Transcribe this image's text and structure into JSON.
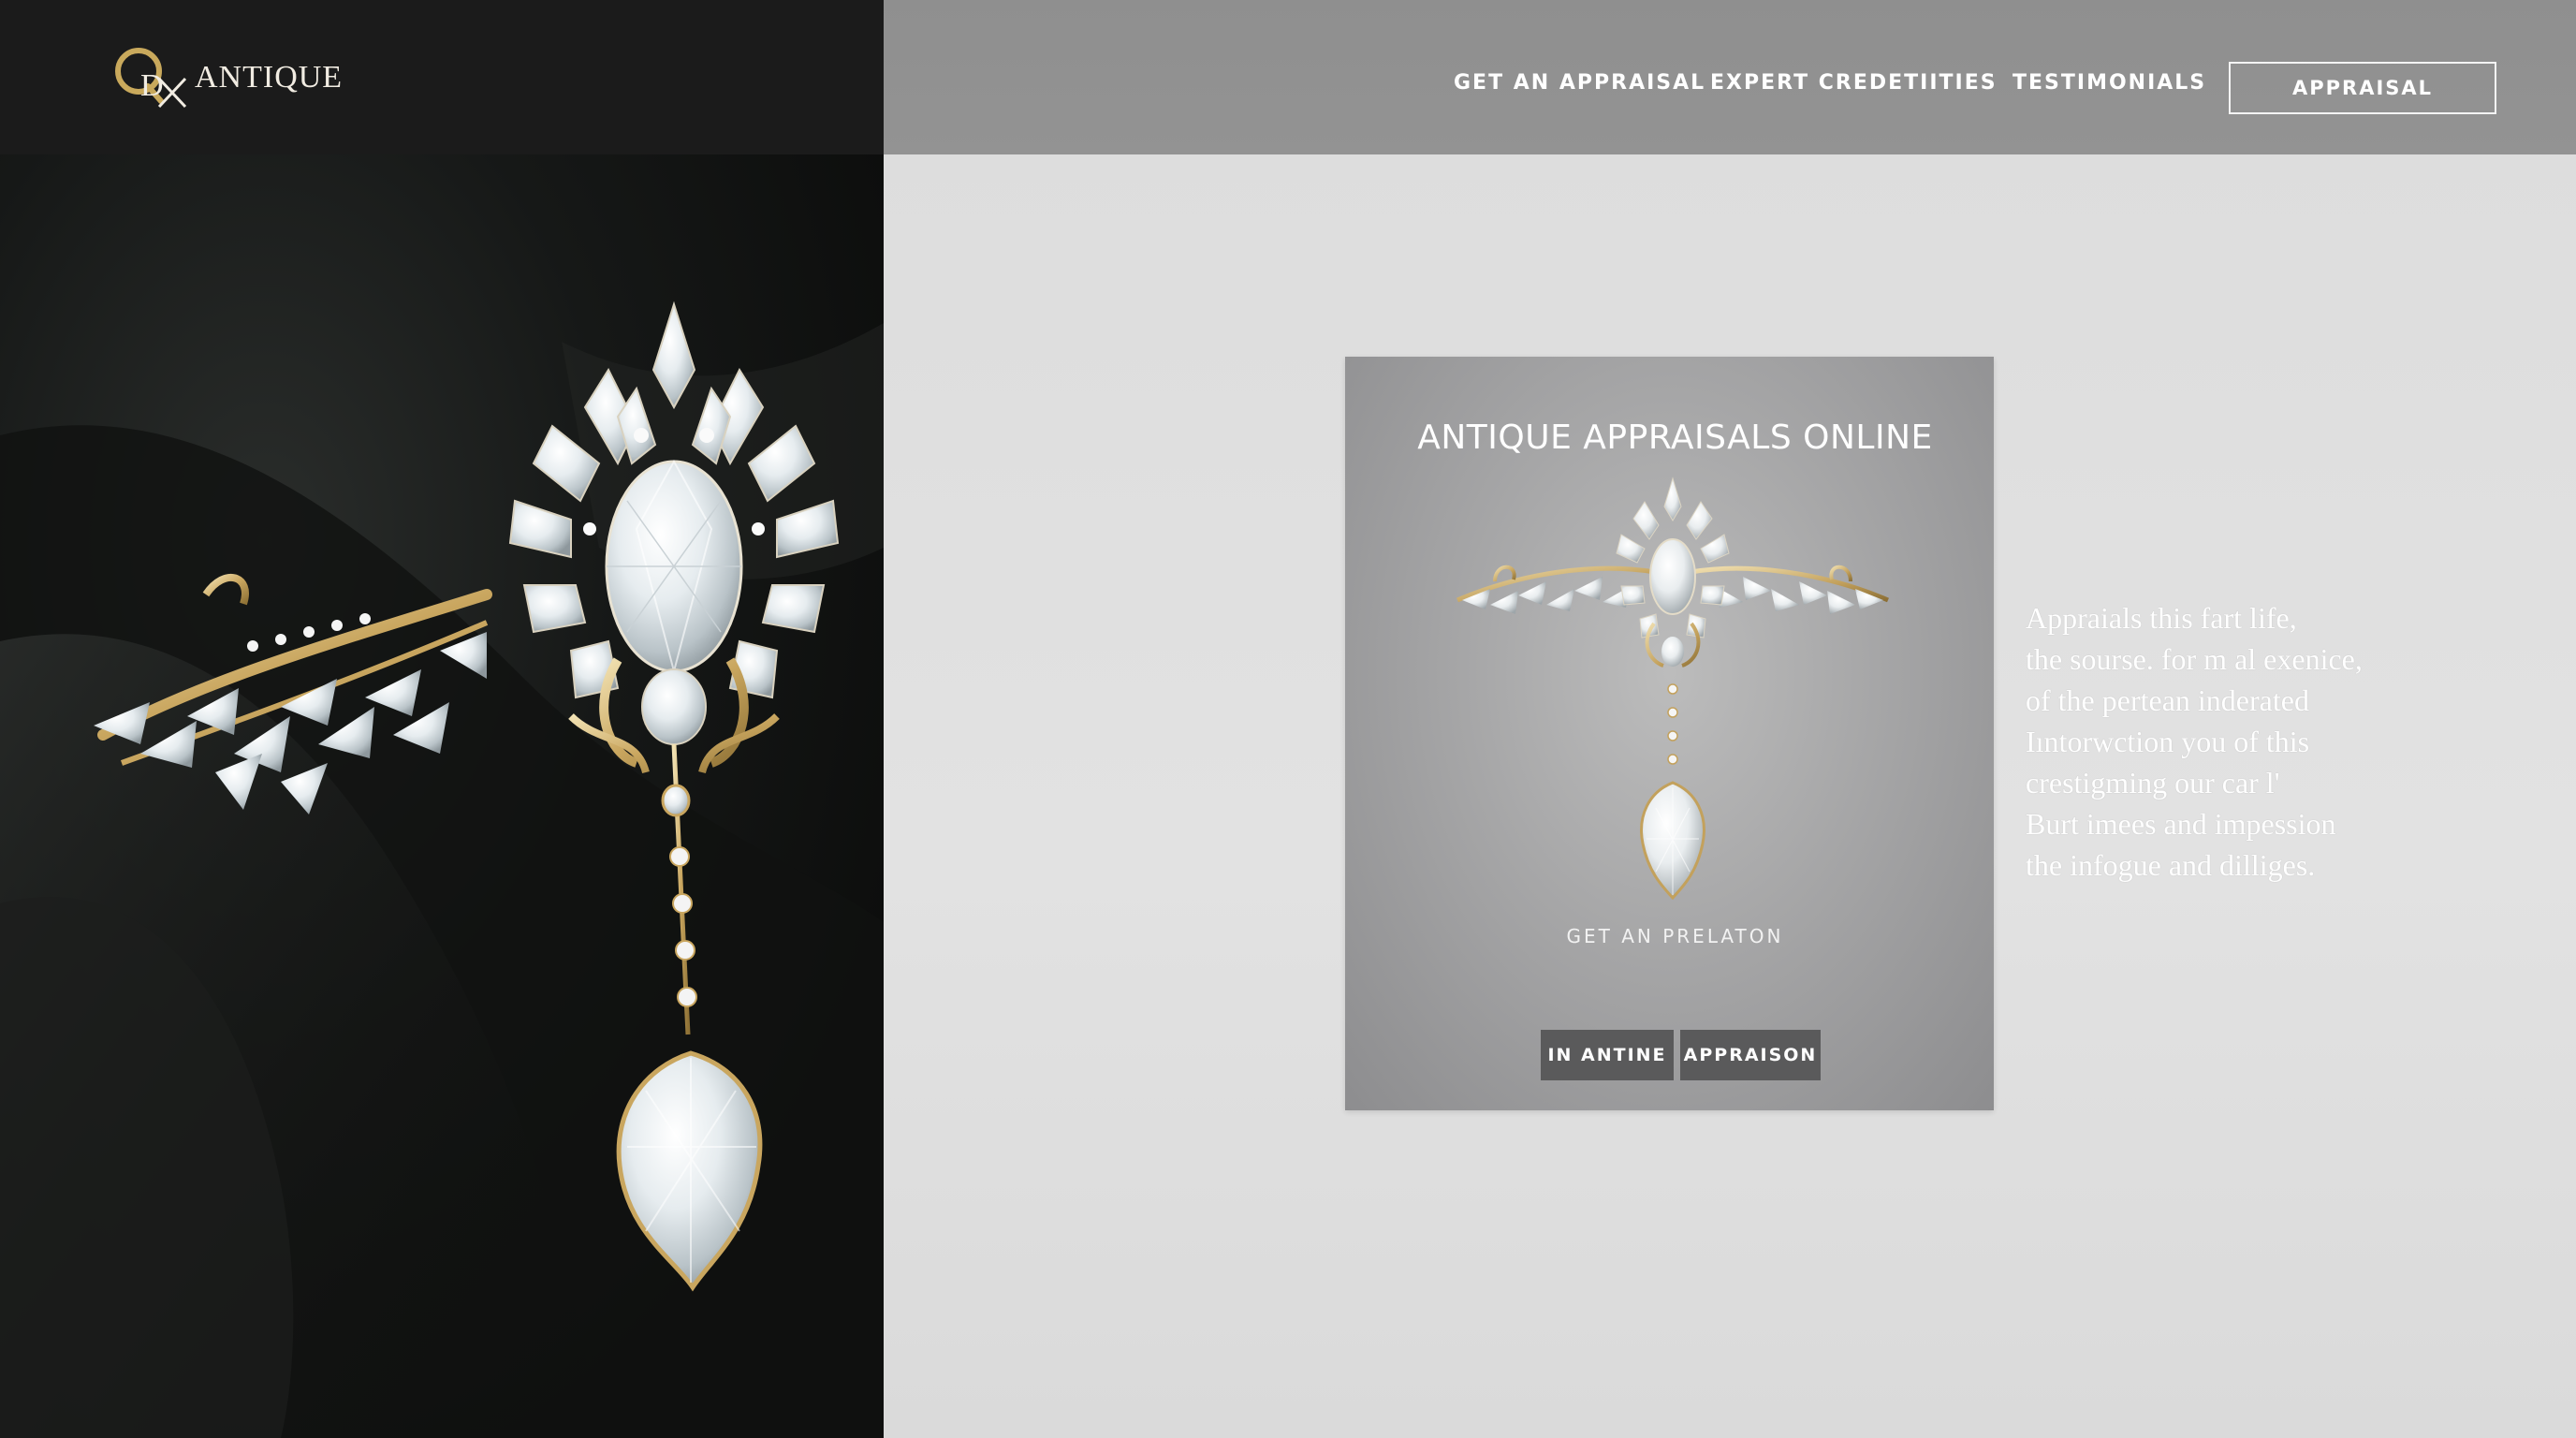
{
  "brand": {
    "name": "ANTIQUE",
    "logo_letters": "QDX"
  },
  "nav": {
    "items": [
      {
        "label": "GET AN APPRAISAL"
      },
      {
        "label": "EXPERT CREDETIITIES"
      },
      {
        "label": "TESTIMONIALS"
      }
    ],
    "cta_label": "APPRAISAL"
  },
  "card": {
    "title": "ANTIQUE APPRAISALS ONLINE",
    "subtitle": "GET AN PRELATON",
    "buttons": [
      {
        "label": "IN ANTINE"
      },
      {
        "label": "APPRAISON"
      }
    ]
  },
  "side_paragraph": {
    "lines": [
      "Appraials this fart life,",
      "the sourse. for m al exenice,",
      "of the pertean inderated",
      "Iıntorwction you of this",
      "crestigming our car l'",
      "Burt imees and impession",
      "the infogue and dilliges."
    ]
  },
  "colors": {
    "left_panel": "#151716",
    "header_dark": "#1b1b1b",
    "nav_bar": "#919191",
    "page_bg": "#dedede",
    "card_bg": "#a6a6a7",
    "card_button": "#5a5a5b",
    "logo_gold": "#c9a95c"
  },
  "icons": {
    "logo": "monogram-logo-icon",
    "hero_image": "diamond-brooch-image",
    "card_image": "diamond-brooch-small-image"
  }
}
